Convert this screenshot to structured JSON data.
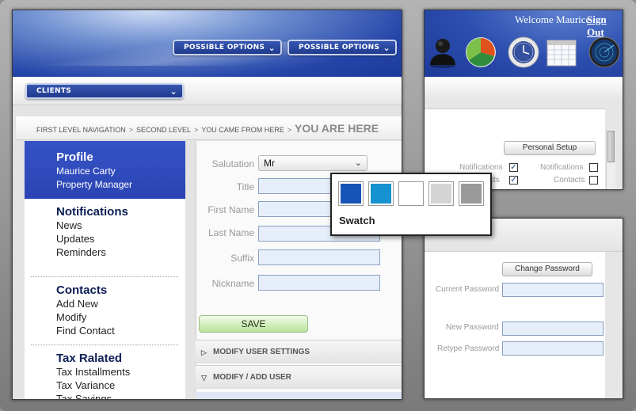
{
  "main": {
    "options": [
      "POSSIBLE OPTIONS",
      "POSSIBLE OPTIONS"
    ],
    "clients_label": "CLIENTS",
    "breadcrumb": {
      "first": "FIRST LEVEL NAVIGATION",
      "second": "SECOND LEVEL",
      "came_from": "YOU CAME FROM HERE",
      "current": "YOU ARE HERE",
      "separator": ">"
    },
    "nav": {
      "profile": {
        "title": "Profile",
        "name": "Maurice Carty",
        "role": "Property Manager"
      },
      "notifications": {
        "title": "Notifications",
        "items": [
          "News",
          "Updates",
          "Reminders"
        ]
      },
      "contacts": {
        "title": "Contacts",
        "items": [
          "Add New",
          "Modify",
          "Find Contact"
        ]
      },
      "tax": {
        "title": "Tax Ralated",
        "items": [
          "Tax Installments",
          "Tax Variance",
          "Tax Savings"
        ]
      }
    },
    "form": {
      "salutation_label": "Salutation",
      "salutation_value": "Mr",
      "title_label": "Title",
      "first_name_label": "First Name",
      "last_name_label": "Last Name",
      "suffix_label": "Suffix",
      "nickname_label": "Nickname",
      "save_label": "SAVE"
    },
    "accordions": [
      "MODIFY USER SETTINGS",
      "MODIFY / ADD USER"
    ]
  },
  "swatch": {
    "title": "Swatch",
    "colors": [
      "#1655b8",
      "#1592cf",
      "#ffffff",
      "#d4d4d4",
      "#9a9a9a"
    ]
  },
  "right_top": {
    "welcome": "Welcome Maurice",
    "sign_out": "Sign Out",
    "personal_setup": "Personal Setup",
    "notifications_label_1": "Notifications",
    "contacts_label_1": "cts",
    "notifications_label_2": "Notifications",
    "contacts_label_2": "Contacts",
    "icons": [
      "user-icon",
      "pie-chart-icon",
      "clock-icon",
      "calendar-icon",
      "radar-icon"
    ]
  },
  "right_bottom": {
    "change_password": "Change Password",
    "current_password": "Current Password",
    "new_password": "New Password",
    "retype_password": "Retype Password"
  }
}
